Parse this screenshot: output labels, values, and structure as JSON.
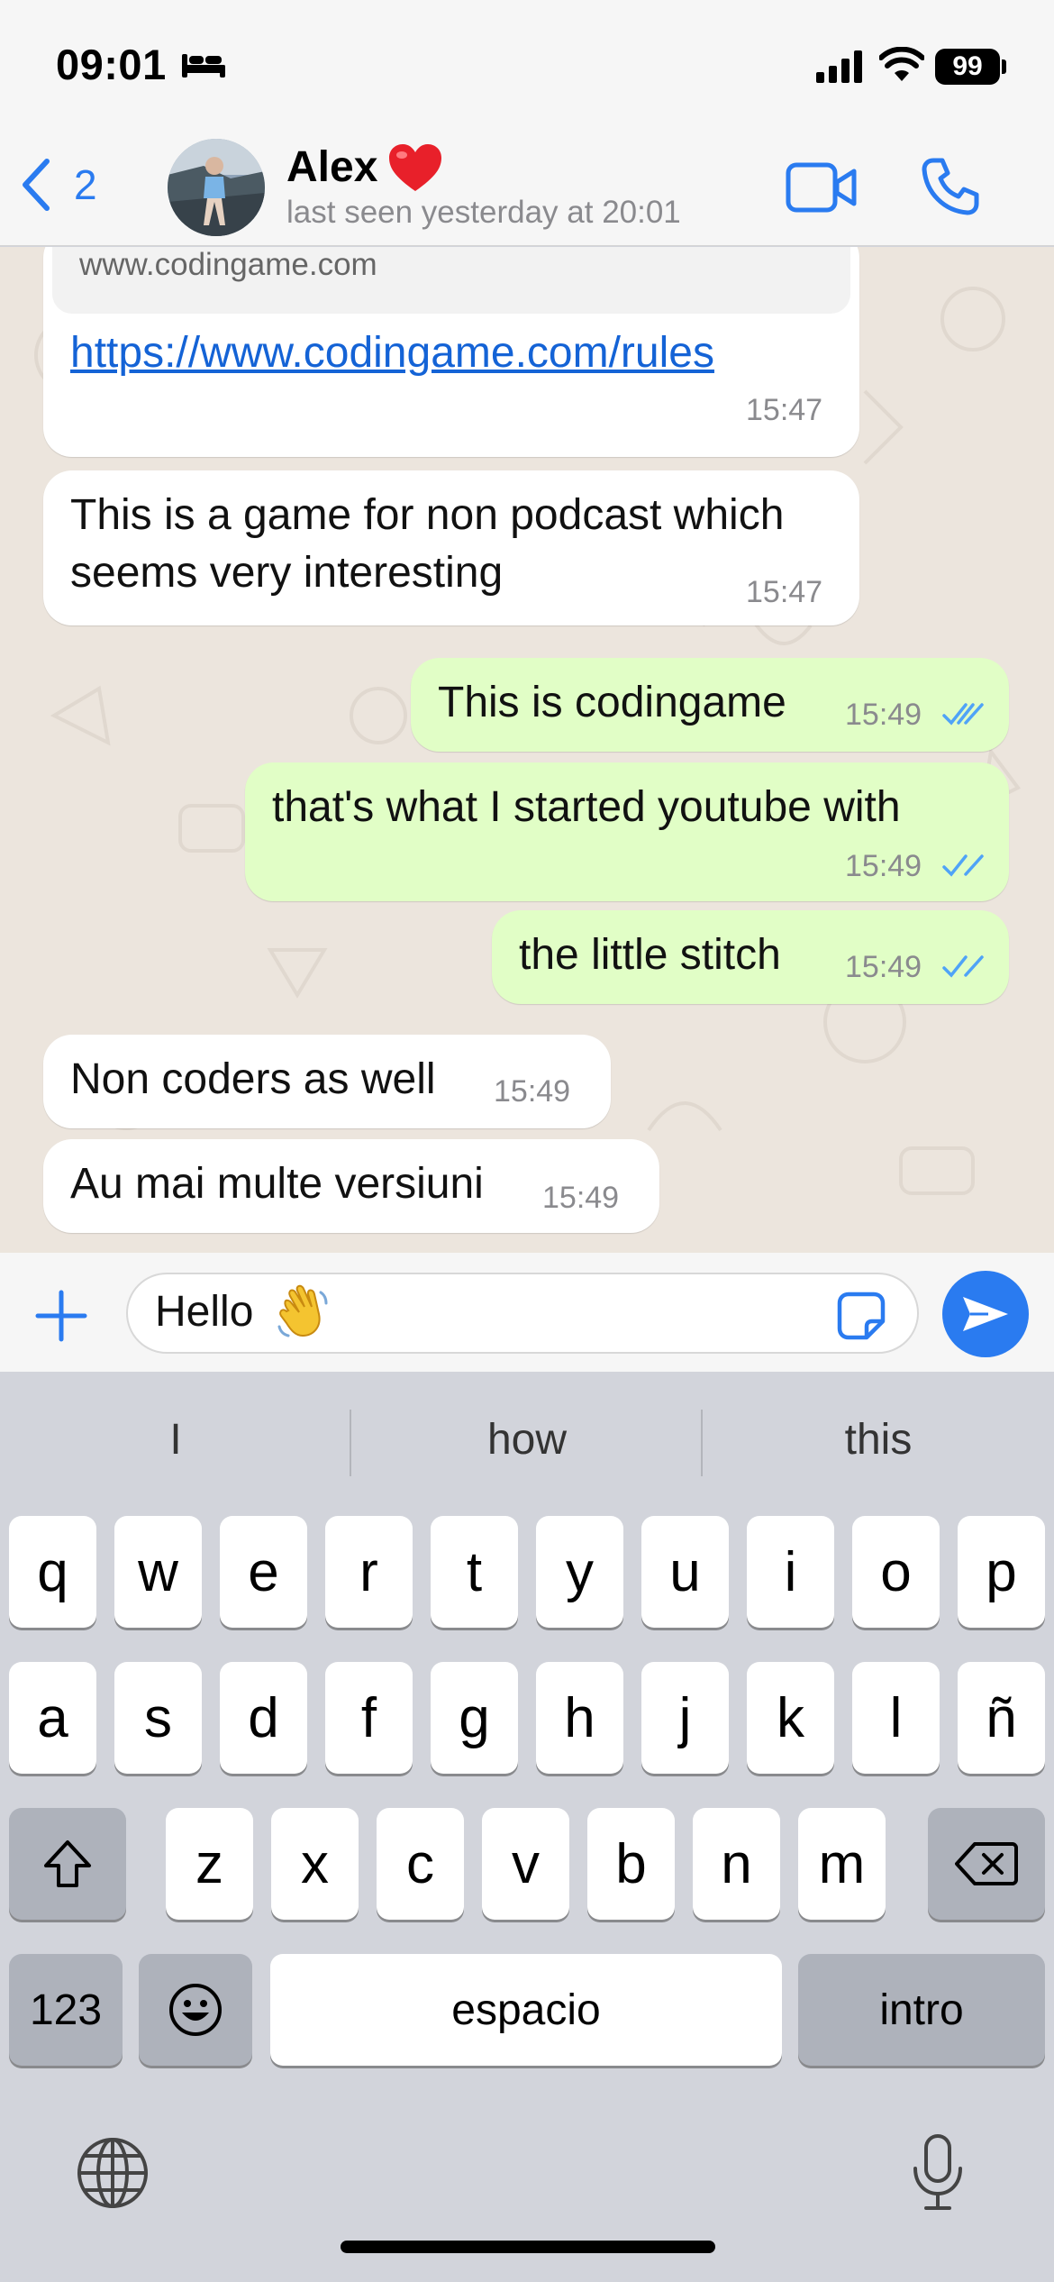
{
  "status_bar": {
    "time": "09:01",
    "battery": "99",
    "icons": [
      "bed-icon",
      "signal-icon",
      "wifi-icon",
      "battery-icon"
    ]
  },
  "header": {
    "back_count": "2",
    "contact_name": "Alex",
    "contact_emoji": "heart-icon",
    "last_seen": "last seen yesterday at 20:01"
  },
  "messages": [
    {
      "direction": "incoming",
      "preview_domain": "www.codingame.com",
      "link": "https://www.codingame.com/rules",
      "time": "15:47"
    },
    {
      "direction": "incoming",
      "lines": [
        "This is a game for non podcast which",
        "seems very interesting"
      ],
      "time": "15:47"
    },
    {
      "direction": "outgoing",
      "text": "This is codingame",
      "time": "15:49",
      "status": "read"
    },
    {
      "direction": "outgoing",
      "text": "that's what I started youtube with",
      "time": "15:49",
      "status": "read"
    },
    {
      "direction": "outgoing",
      "text": "the little stitch",
      "time": "15:49",
      "status": "read"
    },
    {
      "direction": "incoming",
      "text": "Non coders as well",
      "time": "15:49"
    },
    {
      "direction": "incoming",
      "text": "Au mai multe versiuni",
      "time": "15:49"
    }
  ],
  "composer": {
    "text": "Hello",
    "emoji": "waving-hand-icon"
  },
  "keyboard": {
    "suggestions": [
      "I",
      "how",
      "this"
    ],
    "row1": [
      "q",
      "w",
      "e",
      "r",
      "t",
      "y",
      "u",
      "i",
      "o",
      "p"
    ],
    "row2": [
      "a",
      "s",
      "d",
      "f",
      "g",
      "h",
      "j",
      "k",
      "l",
      "ñ"
    ],
    "row3": [
      "z",
      "x",
      "c",
      "v",
      "b",
      "n",
      "m"
    ],
    "numbers_label": "123",
    "space_label": "espacio",
    "return_label": "intro"
  },
  "colors": {
    "accent": "#2a7bf0",
    "incoming_bubble": "#ffffff",
    "outgoing_bubble": "#e1fec6",
    "chat_background": "#ece5dd",
    "read_ticks": "#4fa3f7"
  }
}
